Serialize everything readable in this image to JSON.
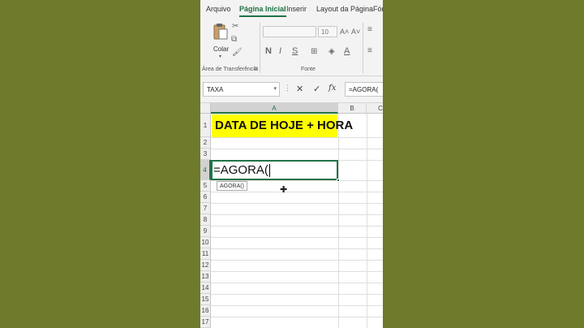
{
  "ribbon": {
    "tabs": [
      "Arquivo",
      "Página Inicial",
      "Inserir",
      "Layout da Página",
      "Fór"
    ],
    "active_tab": "Página Inicial",
    "clipboard": {
      "paste_label": "Colar",
      "group_label": "Área de Transferência"
    },
    "font": {
      "size_value": "10",
      "group_label": "Fonte"
    },
    "dialog_launcher_glyph": "⧉"
  },
  "formula_bar": {
    "name_box": "TAXA",
    "cancel_glyph": "✕",
    "enter_glyph": "✓",
    "fx_label": "fx",
    "content": "=AGORA("
  },
  "grid": {
    "columns": [
      "A",
      "B",
      "C"
    ],
    "rows": [
      "1",
      "2",
      "3",
      "4",
      "5",
      "6",
      "7",
      "8",
      "9",
      "10",
      "11",
      "12",
      "13",
      "14",
      "15",
      "16",
      "17"
    ],
    "title_cell": "DATA DE HOJE + HORA",
    "editing_cell": "=AGORA(",
    "autocomplete_tip": "AGORA()"
  },
  "colors": {
    "accent": "#217346",
    "highlight": "#ffff00",
    "background": "#6f7a2b"
  }
}
